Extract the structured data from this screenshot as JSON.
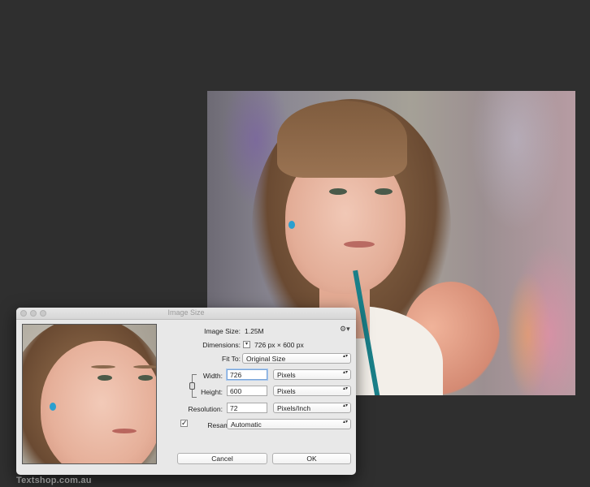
{
  "dialog": {
    "title": "Image Size",
    "image_size_label": "Image Size:",
    "image_size_value": "1.25M",
    "dimensions_label": "Dimensions:",
    "dimensions_value": "726 px  ×  600 px",
    "fit_to_label": "Fit To:",
    "fit_to_value": "Original Size",
    "width_label": "Width:",
    "width_value": "726",
    "width_unit": "Pixels",
    "height_label": "Height:",
    "height_value": "600",
    "height_unit": "Pixels",
    "resolution_label": "Resolution:",
    "resolution_value": "72",
    "resolution_unit": "Pixels/Inch",
    "resample_label": "Resample:",
    "resample_checked": true,
    "resample_value": "Automatic",
    "cancel_label": "Cancel",
    "ok_label": "OK"
  },
  "icons": {
    "checkmark": "✓",
    "gear": "⚙▾",
    "updown": "▴▾",
    "dropdown": "▾"
  },
  "watermark": "Textshop.com.au"
}
